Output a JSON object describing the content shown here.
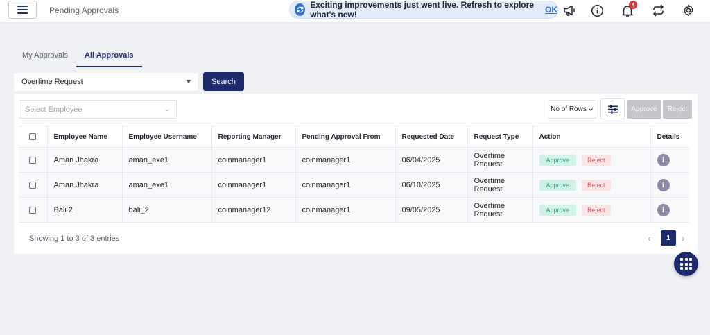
{
  "header": {
    "title": "Pending Approvals",
    "notice_text": "Exciting improvements just went live. Refresh to explore what's new!",
    "notice_ok": "OK",
    "notification_count": "4",
    "icons": [
      "hamburger-menu-icon",
      "refresh-icon",
      "megaphone-icon",
      "info-icon",
      "bell-icon",
      "sync-icon",
      "gear-icon"
    ]
  },
  "tabs": [
    {
      "label": "My Approvals",
      "active": false
    },
    {
      "label": "All Approvals",
      "active": true
    }
  ],
  "filters": {
    "request_type": "Overtime Request",
    "search_label": "Search",
    "employee_placeholder": "Select Employee",
    "rows_label": "No of Rows",
    "approve_label": "Approve",
    "reject_label": "Reject"
  },
  "table": {
    "columns": [
      "Employee Name",
      "Employee Username",
      "Reporting Manager",
      "Pending Approval From",
      "Requested Date",
      "Request Type",
      "Action",
      "Details"
    ],
    "rows": [
      {
        "name": "Aman Jhakra",
        "username": "aman_exe1",
        "manager": "coinmanager1",
        "pending_from": "coinmanager1",
        "date": "06/04/2025",
        "type_line1": "Overtime",
        "type_line2": "Request",
        "approve": "Approve",
        "reject": "Reject",
        "details": "i"
      },
      {
        "name": "Aman Jhakra",
        "username": "aman_exe1",
        "manager": "coinmanager1",
        "pending_from": "coinmanager1",
        "date": "06/10/2025",
        "type_line1": "Overtime",
        "type_line2": "Request",
        "approve": "Approve",
        "reject": "Reject",
        "details": "i"
      },
      {
        "name": "Bali 2",
        "username": "bali_2",
        "manager": "coinmanager12",
        "pending_from": "coinmanager1",
        "date": "09/05/2025",
        "type_line1": "Overtime",
        "type_line2": "Request",
        "approve": "Approve",
        "reject": "Reject",
        "details": "i"
      }
    ]
  },
  "pagination": {
    "showing": "Showing 1 to 3 of 3 entries",
    "current_page": "1",
    "prev": "‹",
    "next": "›"
  },
  "colors": {
    "primary": "#1e2a6e",
    "approve_bg": "#d3f0e8",
    "reject_bg": "#fce3e5",
    "notice_bg": "#e3ecfb",
    "badge": "#e0343a"
  }
}
